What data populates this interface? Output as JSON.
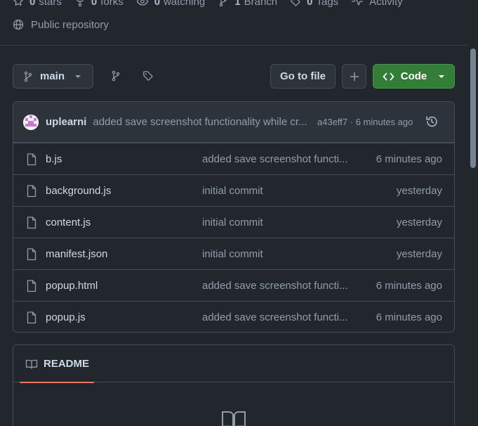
{
  "repo_stats": {
    "stars_count": "0",
    "stars_label": "stars",
    "forks_count": "0",
    "forks_label": "forks",
    "watching_count": "0",
    "watching_label": "watching",
    "branch_count": "1",
    "branch_label": "Branch",
    "tags_count": "0",
    "tags_label": "Tags",
    "activity_label": "Activity"
  },
  "visibility": {
    "label": "Public repository",
    "icon": "globe-icon"
  },
  "toolbar": {
    "branch_name": "main",
    "goto_file_label": "Go to file",
    "add_file_icon": "plus-icon",
    "code_label": "Code"
  },
  "latest_commit": {
    "author": "uplearni",
    "message": "added save screenshot functionality while cr...",
    "meta": "a43eff7 · 6 minutes ago"
  },
  "files": [
    {
      "name": "b.js",
      "commit": "added save screenshot functi...",
      "time": "6 minutes ago"
    },
    {
      "name": "background.js",
      "commit": "initial commit",
      "time": "yesterday"
    },
    {
      "name": "content.js",
      "commit": "initial commit",
      "time": "yesterday"
    },
    {
      "name": "manifest.json",
      "commit": "initial commit",
      "time": "yesterday"
    },
    {
      "name": "popup.html",
      "commit": "added save screenshot functi...",
      "time": "6 minutes ago"
    },
    {
      "name": "popup.js",
      "commit": "added save screenshot functi...",
      "time": "6 minutes ago"
    }
  ],
  "readme": {
    "tab_label": "README"
  },
  "colors": {
    "background": "#22272e",
    "code_button": "#347d39",
    "readme_underline": "#ec775c"
  }
}
